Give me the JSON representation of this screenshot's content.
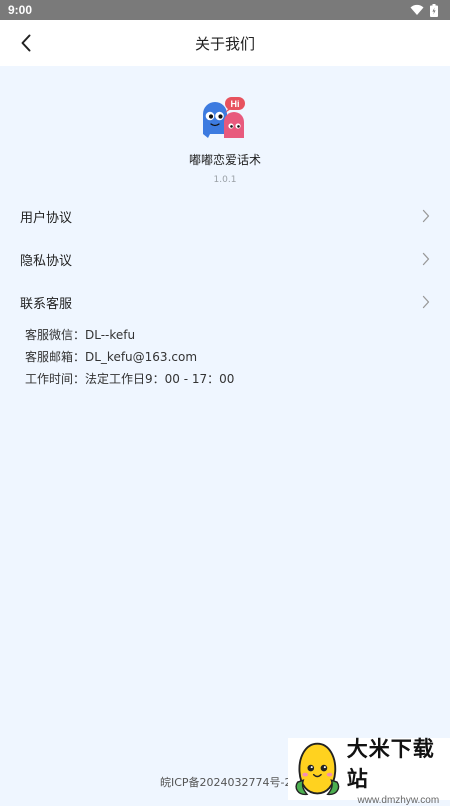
{
  "status_bar": {
    "time": "9:00",
    "icons": [
      "wifi-icon",
      "battery-icon"
    ]
  },
  "header": {
    "title": "关于我们",
    "back_icon": "chevron-left-icon"
  },
  "app": {
    "name": "嘟嘟恋爱话术",
    "version": "1.0.1",
    "logo_text": "Hi"
  },
  "menu": [
    {
      "label": "用户协议",
      "icon": "chevron-right-icon"
    },
    {
      "label": "隐私协议",
      "icon": "chevron-right-icon"
    },
    {
      "label": "联系客服",
      "icon": "chevron-right-icon"
    }
  ],
  "contact": {
    "wechat": "客服微信：DL--kefu",
    "email": "客服邮箱：DL_kefu@163.com",
    "hours": "工作时间：法定工作日9：00 - 17：00"
  },
  "footer": {
    "icp": "皖ICP备2024032774号-2"
  },
  "watermark": {
    "title": "大米下载站",
    "url": "www.dmzhyw.com"
  },
  "colors": {
    "background": "#eff6ff",
    "header": "#ffffff",
    "status_bar": "#7a7a7a",
    "logo_blue": "#3d7be0",
    "logo_pink": "#e85a7d",
    "hi_bubble": "#e7525e"
  }
}
